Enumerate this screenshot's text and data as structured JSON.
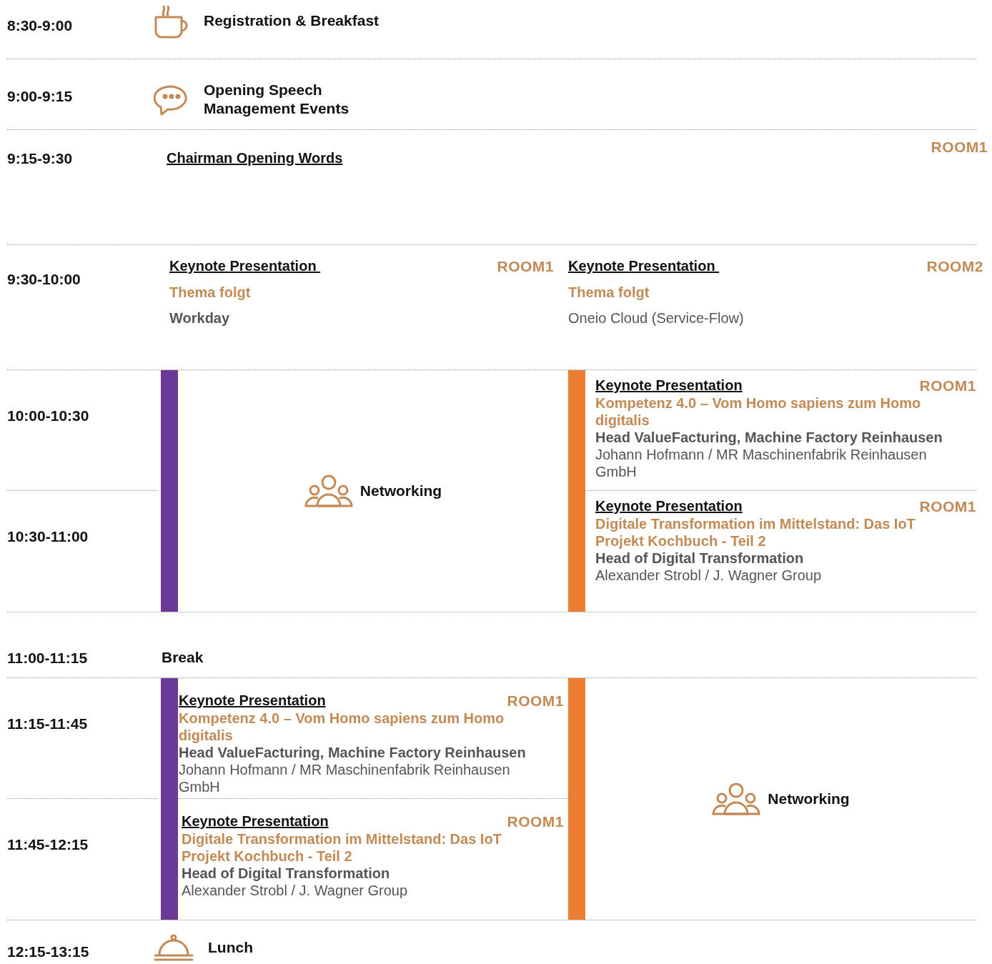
{
  "agenda": [
    {
      "kind": "breakfast",
      "time": "8:30-9:00",
      "title": [
        "Registration & Breakfast"
      ]
    },
    {
      "kind": "speech",
      "time": "9:00-9:15",
      "title": [
        "Opening Speech",
        "Management Events"
      ]
    },
    {
      "kind": "chairman",
      "time": "9:15-9:30",
      "label": "Chairman Opening Words",
      "room": "ROOM1"
    },
    {
      "kind": "parallel",
      "time": "9:30-10:00",
      "sessions": [
        {
          "label": "Keynote Presentation ",
          "room": "ROOM1",
          "title": "Thema folgt",
          "role": "Workday"
        },
        {
          "label": "Keynote Presentation ",
          "room": "ROOM2",
          "title": "Thema folgt",
          "speaker": "Oneio Cloud (Service-Flow)"
        }
      ]
    },
    {
      "kind": "block",
      "times": [
        "10:00-10:30",
        "10:30-11:00"
      ],
      "left": {
        "kind": "networking",
        "color": "#6b3a96",
        "label": "Networking"
      },
      "right": {
        "kind": "sessions",
        "color": "#ed7d31",
        "sessions": [
          {
            "label": "Keynote Presentation",
            "room": "ROOM1",
            "title": "Kompetenz 4.0 – Vom Homo sapiens zum Homo digitalis",
            "role": "Head ValueFacturing, Machine Factory Reinhausen",
            "speaker": "Johann Hofmann / MR Maschinenfabrik Reinhausen GmbH"
          },
          {
            "label": "Keynote Presentation",
            "room": "ROOM1",
            "title": "Digitale Transformation im Mittelstand: Das IoT Projekt Kochbuch - Teil 2",
            "role": "Head of Digital Transformation",
            "speaker": "Alexander Strobl / J. Wagner Group"
          }
        ]
      }
    },
    {
      "kind": "break",
      "time": "11:00-11:15",
      "label": "Break"
    },
    {
      "kind": "block",
      "times": [
        "11:15-11:45",
        "11:45-12:15"
      ],
      "left": {
        "kind": "sessions",
        "color": "#6b3a96",
        "sessions": [
          {
            "label": "Keynote Presentation",
            "room": "ROOM1",
            "title": "Kompetenz 4.0 – Vom Homo sapiens zum Homo digitalis",
            "role": "Head ValueFacturing, Machine Factory Reinhausen",
            "speaker": "Johann Hofmann / MR Maschinenfabrik Reinhausen GmbH"
          },
          {
            "label": "Keynote Presentation",
            "room": "ROOM1",
            "title": "Digitale Transformation im Mittelstand: Das IoT Projekt Kochbuch - Teil 2",
            "role": "Head of Digital Transformation",
            "speaker": "Alexander Strobl / J. Wagner Group"
          }
        ]
      },
      "right": {
        "kind": "networking",
        "color": "#ed7d31",
        "label": "Networking"
      }
    },
    {
      "kind": "lunch",
      "time": "12:15-13:15",
      "title": [
        "Lunch"
      ]
    }
  ]
}
